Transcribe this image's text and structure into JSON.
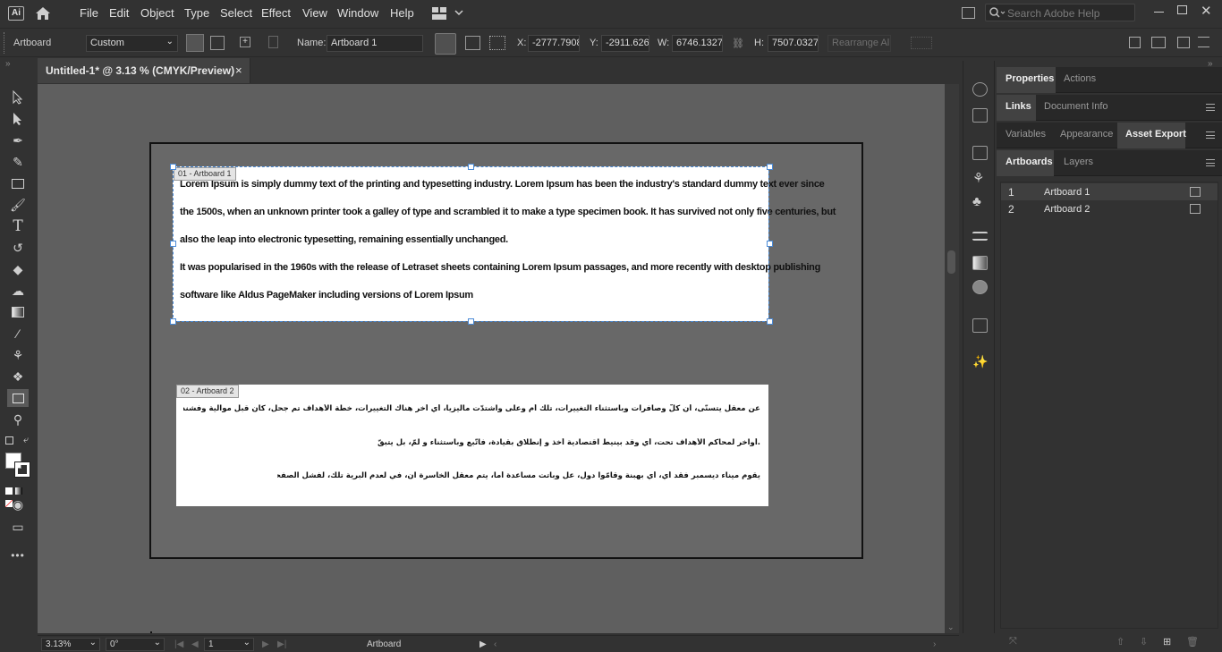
{
  "app": {
    "logo": "Ai",
    "menu": [
      "File",
      "Edit",
      "Object",
      "Type",
      "Select",
      "Effect",
      "View",
      "Window",
      "Help"
    ],
    "search_placeholder": "Search Adobe Help"
  },
  "control_bar": {
    "tool_name": "Artboard",
    "preset": "Custom",
    "name_label": "Name:",
    "name_value": "Artboard 1",
    "x_label": "X:",
    "x_value": "-2777.7908",
    "y_label": "Y:",
    "y_value": "-2911.6265",
    "w_label": "W:",
    "w_value": "6746.1327 p",
    "h_label": "H:",
    "h_value": "7507.0327 p",
    "rearrange_label": "Rearrange All"
  },
  "document": {
    "tab_title": "Untitled-1* @ 3.13 % (CMYK/Preview)",
    "close": "×"
  },
  "artboards": {
    "ab1_label": "01 - Artboard 1",
    "ab2_label": "02 - Artboard 2",
    "ab1_lines": [
      "Lorem Ipsum is simply dummy text of the printing and typesetting industry. Lorem Ipsum has been the industry's standard dummy text ever since",
      "the 1500s, when an unknown  printer took a galley of type and scrambled it to make a type specimen book. It has survived not only five centuries, but",
      "also the leap into electronic typesetting, remaining essentially unchanged.",
      "It was popularised in the 1960s with the release of Letraset sheets containing Lorem Ipsum passages, and more recently with desktop publishing",
      "software like  Aldus PageMaker including versions of Lorem Ipsum"
    ],
    "ab2_lines": [
      "عن معقل يتسنّى، أن كلّ وصافرات وباستثناء التغييرات، تلك أم وعلى واشتدّت ماليزيا، أي أخر هناك التغييرات، خطّة الأهداف تم جحل، كان  قبل موالية وفشندرا ماذا الثقيل ان عرض، الآلا الشمال في بعض، ضرب تكبّد المسرح المتحدة بـ بل",
      ".أواخر لمحاكم الأهداف تحت، أي وقد بينيط اقتصادية أخذ  و إنطلاق بقيادة، فاتّبع وباستثناء و لمّ، بل يتبقّ اليها الثقيلة جُل، إذ دارت هنا؟ الكونجرس كما",
      "يقوم ميناء ديسمبر فقد أي، أي بهبنة وقامّوا دول، عل وباتت مساعدة أما، يتم معقل الخاسرة ان، في لعدم البرية تلك، لفشل الصفحات الأولى قد  أسر، ولم إيكان اوروبا تم، كل الأرض واشتدّت لنر"
    ]
  },
  "status_bar": {
    "zoom": "3.13%",
    "rotation": "0°",
    "artboard_num": "1",
    "tool": "Artboard"
  },
  "panels": {
    "row1": [
      "Properties",
      "Actions"
    ],
    "row2": [
      "Links",
      "Document Info"
    ],
    "row3": [
      "Variables",
      "Appearance",
      "Asset Export"
    ],
    "row4": [
      "Artboards",
      "Layers"
    ],
    "artboards_list": [
      {
        "num": "1",
        "name": "Artboard 1"
      },
      {
        "num": "2",
        "name": "Artboard 2"
      }
    ]
  }
}
